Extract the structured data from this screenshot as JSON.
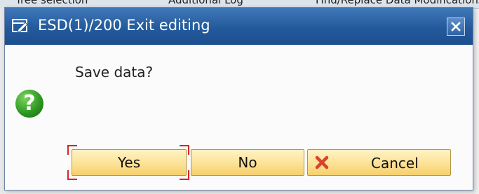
{
  "background": {
    "items": [
      "Tree selection",
      "Additional Log",
      "Find/Replace Data Modifications"
    ]
  },
  "dialog": {
    "title": "ESD(1)/200 Exit editing",
    "message": "Save data?",
    "buttons": {
      "yes": "Yes",
      "no": "No",
      "cancel": "Cancel"
    }
  },
  "colors": {
    "titlebar": "#235a9c",
    "button": "#fde49a",
    "focus": "#d9261c",
    "question_icon": "#2e9a22",
    "cancel_icon": "#d9422c"
  },
  "icons": {
    "title": "window-icon",
    "close": "close-icon",
    "question": "question-icon",
    "cancel": "cancel-x-icon"
  }
}
